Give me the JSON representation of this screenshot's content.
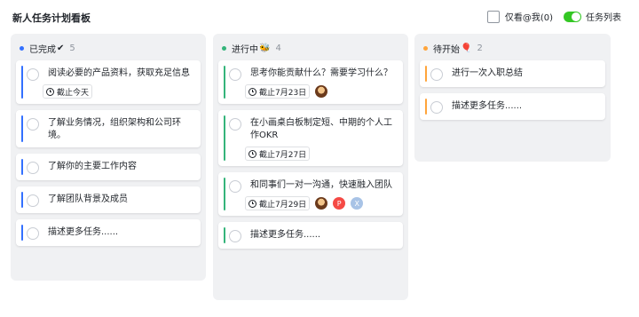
{
  "header": {
    "title": "新人任务计划看板",
    "only_mine_label": "仅看@我(0)",
    "task_list_label": "任务列表"
  },
  "colors": {
    "done": "#3370ff",
    "in_progress": "#34b47a",
    "todo": "#ffa43a",
    "toggle_on": "#34c724"
  },
  "columns": [
    {
      "title": "已完成",
      "emoji": "✔",
      "count": "5",
      "cards": [
        {
          "text": "阅读必要的产品资料，获取充足信息",
          "due": "截止今天"
        },
        {
          "text": "了解业务情况，组织架构和公司环境。"
        },
        {
          "text": "了解你的主要工作内容"
        },
        {
          "text": "了解团队背景及成员"
        },
        {
          "text": "描述更多任务......"
        }
      ]
    },
    {
      "title": "进行中",
      "emoji": "🐝",
      "count": "4",
      "cards": [
        {
          "text": "思考你能贡献什么？需要学习什么？",
          "due": "截止7月23日"
        },
        {
          "text": "在小画桌白板制定短、中期的个人工作OKR",
          "due": "截止7月27日"
        },
        {
          "text": "和同事们一对一沟通，快速融入团队",
          "due": "截止7月29日",
          "avatar_p": "P",
          "avatar_x": "X"
        },
        {
          "text": "描述更多任务......"
        }
      ]
    },
    {
      "title": "待开始",
      "emoji": "🎈",
      "count": "2",
      "cards": [
        {
          "text": "进行一次入职总结"
        },
        {
          "text": "描述更多任务......"
        }
      ]
    }
  ]
}
